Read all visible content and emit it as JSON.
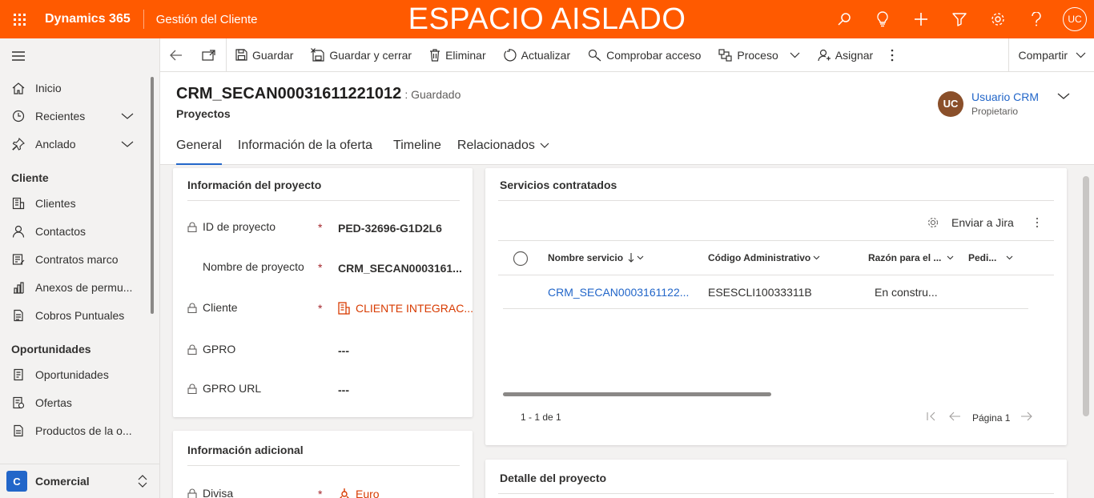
{
  "topbar": {
    "app_name": "Dynamics 365",
    "module_name": "Gestión del Cliente",
    "banner": "ESPACIO AISLADO",
    "user_initials": "UC",
    "background": "#ff5a00"
  },
  "sidebar": {
    "nav": [
      {
        "label": "Inicio",
        "icon": "home-icon"
      },
      {
        "label": "Recientes",
        "icon": "clock-icon"
      },
      {
        "label": "Anclado",
        "icon": "pin-icon"
      }
    ],
    "groups": [
      {
        "title": "Cliente",
        "items": [
          {
            "label": "Clientes",
            "icon": "accounts-icon"
          },
          {
            "label": "Contactos",
            "icon": "person-icon"
          },
          {
            "label": "Contratos marco",
            "icon": "contract-icon"
          },
          {
            "label": "Anexos de permu...",
            "icon": "annex-icon"
          },
          {
            "label": "Cobros Puntuales",
            "icon": "document-icon"
          }
        ]
      },
      {
        "title": "Oportunidades",
        "items": [
          {
            "label": "Oportunidades",
            "icon": "opportunity-icon"
          },
          {
            "label": "Ofertas",
            "icon": "quote-icon"
          },
          {
            "label": "Productos de la o...",
            "icon": "product-icon"
          }
        ]
      }
    ],
    "area": {
      "badge": "C",
      "label": "Comercial"
    }
  },
  "commands": {
    "save": "Guardar",
    "save_close": "Guardar y cerrar",
    "delete": "Eliminar",
    "refresh": "Actualizar",
    "check_access": "Comprobar acceso",
    "process": "Proceso",
    "assign": "Asignar",
    "share": "Compartir"
  },
  "record": {
    "title": "CRM_SECAN00031611221012",
    "status": ": Guardado",
    "entity": "Proyectos",
    "owner_initials": "UC",
    "owner_name": "Usuario CRM",
    "owner_role": "Propietario"
  },
  "tabs": [
    {
      "label": "General",
      "active": true
    },
    {
      "label": "Información de la oferta",
      "active": false
    },
    {
      "label": "Timeline",
      "active": false
    },
    {
      "label": "Relacionados",
      "active": false
    }
  ],
  "project_info": {
    "title": "Información del proyecto",
    "fields": [
      {
        "label": "ID de proyecto",
        "value": "PED-32696-G1D2L6"
      },
      {
        "label": "Nombre de proyecto",
        "value": "CRM_SECAN0003161..."
      },
      {
        "label": "Cliente",
        "value": "CLIENTE INTEGRAC..."
      },
      {
        "label": "GPRO",
        "value": "---"
      },
      {
        "label": "GPRO URL",
        "value": "---"
      }
    ]
  },
  "additional_info": {
    "title": "Información adicional",
    "fields": [
      {
        "label": "Divisa",
        "value": "Euro"
      }
    ]
  },
  "services": {
    "title": "Servicios contratados",
    "send_jira": "Enviar a Jira",
    "columns": [
      "Nombre servicio",
      "Código Administrativo",
      "Razón para el ...",
      "Pedi..."
    ],
    "rows": [
      {
        "name": "CRM_SECAN0003161122...",
        "code": "ESESCLI10033311B",
        "reason": "En constru..."
      }
    ],
    "count": "1 - 1 de 1",
    "page": "Página 1"
  },
  "project_detail": {
    "title": "Detalle del proyecto"
  }
}
